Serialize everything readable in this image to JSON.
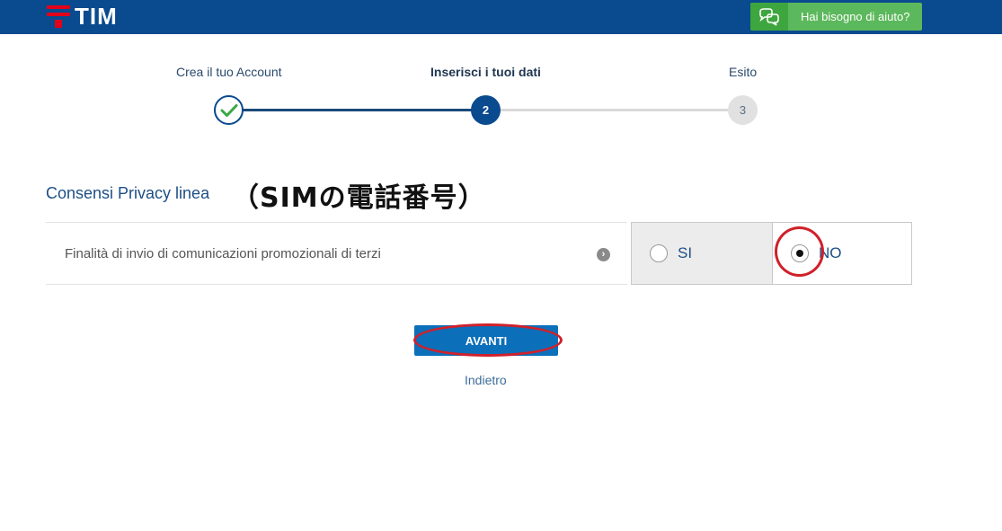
{
  "header": {
    "logo_text": "TIM",
    "help_label": "Hai bisogno di aiuto?"
  },
  "stepper": {
    "steps": [
      {
        "label": "Crea il tuo Account",
        "state": "completed"
      },
      {
        "label": "Inserisci i tuoi dati",
        "state": "active",
        "number": "2"
      },
      {
        "label": "Esito",
        "state": "pending",
        "number": "3"
      }
    ]
  },
  "section": {
    "title": "Consensi Privacy linea",
    "annotation": "（SIMの電話番号）"
  },
  "consent": {
    "text": "Finalità di invio di comunicazioni promozionali di terzi",
    "info_glyph": "›",
    "options": [
      {
        "label": "SI",
        "selected": false
      },
      {
        "label": "NO",
        "selected": true
      }
    ]
  },
  "actions": {
    "next_label": "AVANTI",
    "back_label": "Indietro"
  },
  "colors": {
    "brand_blue": "#0a4a8f",
    "brand_red": "#e2001a",
    "help_green": "#5cb85c",
    "button_blue": "#0c6fba",
    "annotation_red": "#d0202a"
  }
}
